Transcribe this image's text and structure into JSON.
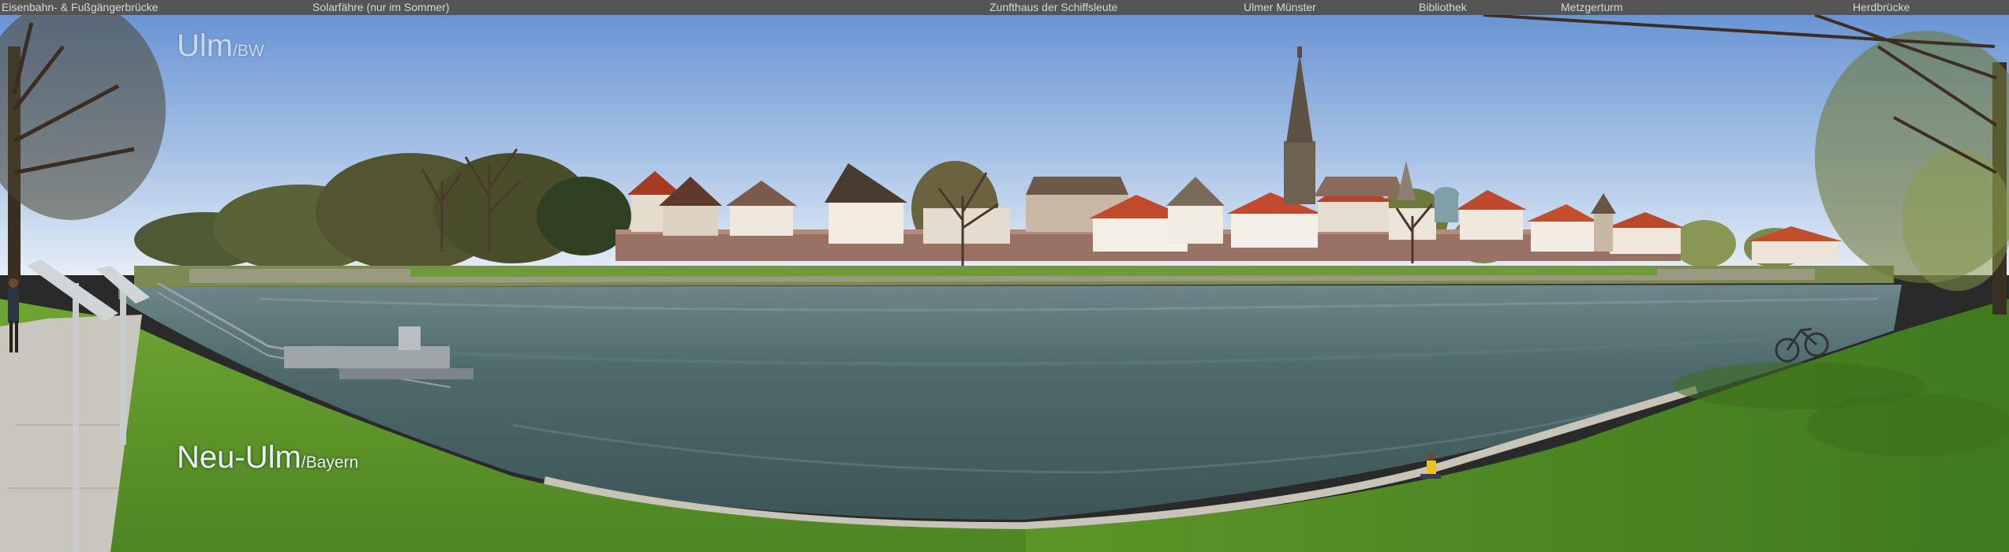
{
  "landmarks": [
    {
      "label": "Eisenbahn- & Fußgängerbrücke"
    },
    {
      "label": "Solarfähre (nur im Sommer)"
    },
    {
      "label": "Zunfthaus der Schiffsleute"
    },
    {
      "label": "Ulmer Münster"
    },
    {
      "label": "Bibliothek"
    },
    {
      "label": "Metzgerturm"
    },
    {
      "label": "Herdbrücke"
    }
  ],
  "captions": {
    "north_city": "Ulm",
    "north_state": "/BW",
    "south_city": "Neu-Ulm",
    "south_state": "/Bayern"
  },
  "colors": {
    "sky_top": "#6f9ad6",
    "sky_bottom": "#dfe9f4",
    "river": "#4d6a6c",
    "grass": "#5f9a2c",
    "roofs": "#b5452a",
    "label_bar": "#555555"
  }
}
